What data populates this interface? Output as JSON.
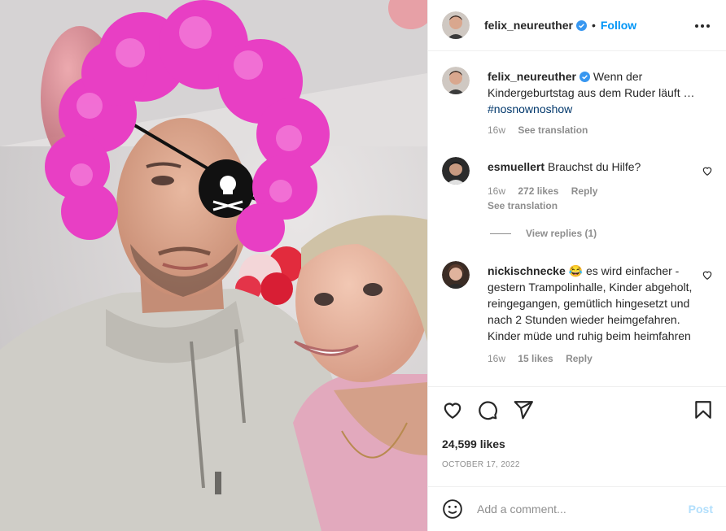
{
  "post": {
    "username": "felix_neureuther",
    "follow_label": "Follow",
    "separator": "•",
    "caption_text": "Wenn der Kindergeburtstag aus dem Ruder läuft …",
    "caption_tag": "#nosnownoshow",
    "caption_time": "16w",
    "caption_translate": "See translation",
    "likes": "24,599 likes",
    "date": "OCTOBER 17, 2022"
  },
  "comments": [
    {
      "username": "esmuellert",
      "text": "Brauchst du Hilfe?",
      "time": "16w",
      "likes": "272 likes",
      "reply": "Reply",
      "translate": "See translation",
      "view_replies": "View replies (1)"
    },
    {
      "username": "nickischnecke",
      "emoji": "😂",
      "text": "es wird einfacher - gestern Trampolinhalle, Kinder abgeholt, reingegangen, gemütlich hingesetzt und nach 2 Stunden wieder heimgefahren. Kinder müde und ruhig beim heimfahren",
      "time": "16w",
      "likes": "15 likes",
      "reply": "Reply"
    }
  ],
  "add_comment": {
    "placeholder": "Add a comment...",
    "post_label": "Post"
  },
  "icons": {
    "more": "more-horizontal-icon",
    "like": "heart-icon",
    "comment": "comment-icon",
    "share": "send-icon",
    "save": "bookmark-icon",
    "emoji": "emoji-icon",
    "verified": "verified-badge-icon"
  },
  "colors": {
    "accent": "#0095f6",
    "verified": "#3897f0",
    "muted": "#8e8e8e",
    "wig": "#e83fc4"
  }
}
